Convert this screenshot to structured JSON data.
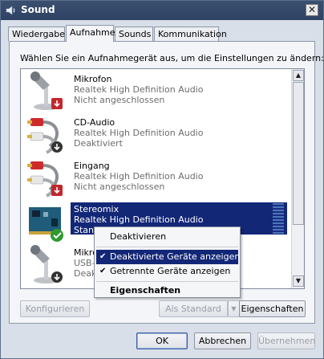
{
  "window": {
    "title": "Sound",
    "close_label": "✕"
  },
  "tabs": [
    {
      "label": "Wiedergabe"
    },
    {
      "label": "Aufnahme"
    },
    {
      "label": "Sounds"
    },
    {
      "label": "Kommunikation"
    }
  ],
  "active_tab": "Aufnahme",
  "instruction": "Wählen Sie ein Aufnahmegerät aus, um die Einstellungen zu ändern:",
  "devices": [
    {
      "name": "Mikrofon",
      "driver": "Realtek High Definition Audio",
      "status": "Nicht angeschlossen",
      "icon": "microphone-icon",
      "badge": "unplugged-arrow-badge"
    },
    {
      "name": "CD-Audio",
      "driver": "Realtek High Definition Audio",
      "status": "Deaktiviert",
      "icon": "rca-cable-icon",
      "badge": "disabled-arrow-badge"
    },
    {
      "name": "Eingang",
      "driver": "Realtek High Definition Audio",
      "status": "Nicht angeschlossen",
      "icon": "rca-cable-icon",
      "badge": "unplugged-arrow-badge"
    },
    {
      "name": "Stereomix",
      "driver": "Realtek High Definition Audio",
      "status": "Stand",
      "icon": "sound-card-icon",
      "badge": "default-check-badge",
      "selected": true
    },
    {
      "name": "Mikro",
      "driver": "USB-",
      "status": "Deak",
      "icon": "microphone-icon",
      "badge": "disabled-arrow-badge"
    }
  ],
  "context_menu": {
    "items": [
      {
        "label": "Deaktivieren",
        "checked": false,
        "bold": false
      },
      {
        "label": "Deaktivierte Geräte anzeigen",
        "checked": true,
        "bold": false,
        "highlighted": true
      },
      {
        "label": "Getrennte Geräte anzeigen",
        "checked": true,
        "bold": false
      },
      {
        "label": "Eigenschaften",
        "checked": false,
        "bold": true
      }
    ]
  },
  "panel_buttons": {
    "configure": "Konfigurieren",
    "set_default": "Als Standard",
    "properties": "Eigenschaften"
  },
  "dialog_buttons": {
    "ok": "OK",
    "cancel": "Abbrechen",
    "apply": "Übernehmen"
  },
  "colors": {
    "selection": "#132777",
    "title_bar": "#2e4263",
    "disabled_badge": "#333333",
    "unplugged_badge": "#c0272d",
    "default_badge": "#2e9a2e"
  }
}
